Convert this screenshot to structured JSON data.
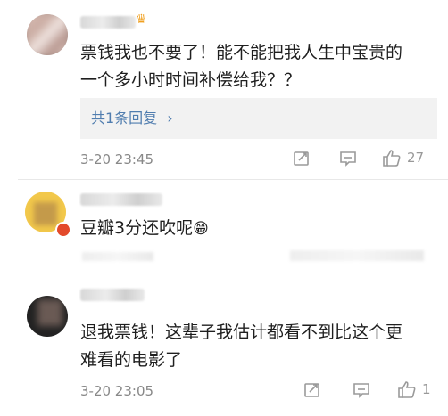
{
  "comments": [
    {
      "text_line1": "票钱我也不要了！能不能把我人生中宝贵的",
      "text_line2": "一个多小时时间补偿给我？？",
      "replies_label": "共1条回复",
      "replies_chevron": "›",
      "time": "3-20 23:45",
      "likes": "27"
    },
    {
      "text": "豆瓣3分还吹呢",
      "emoji": "😁"
    },
    {
      "text_line1": "退我票钱！这辈子我估计都看不到比这个更",
      "text_line2": "难看的电影了",
      "time": "3-20 23:05",
      "likes": "1"
    }
  ],
  "icons": {
    "crown": "crown-icon",
    "repost": "repost-icon",
    "comment": "comment-icon",
    "like": "thumbs-up-icon",
    "vip_badge": "badge-icon"
  },
  "colors": {
    "link": "#507daf",
    "meta": "#888888",
    "badge": "#e34a2c"
  }
}
